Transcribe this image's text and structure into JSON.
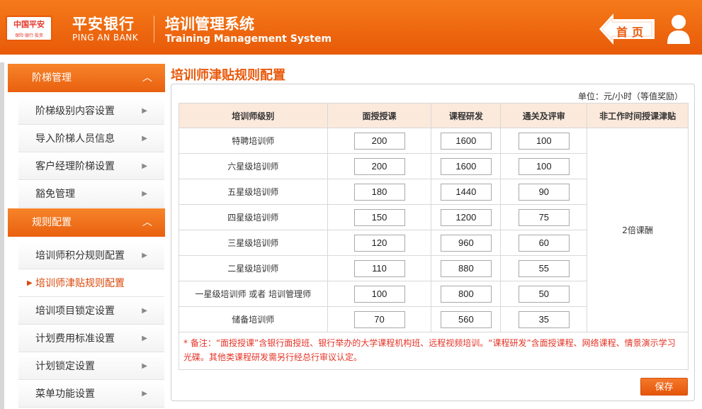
{
  "header": {
    "logo_text": "中国平安",
    "logo_sub": "保险·银行·投资",
    "bank_cn": "平安银行",
    "bank_en": "PING AN BANK",
    "system_cn": "培训管理系统",
    "system_en": "Training Management System",
    "home_label": "首页",
    "user_icon": "user-icon"
  },
  "sidebar": {
    "sections": [
      {
        "title": "阶梯管理",
        "items": [
          "阶梯级别内容设置",
          "导入阶梯人员信息",
          "客户经理阶梯设置",
          "豁免管理"
        ]
      },
      {
        "title": "规则配置",
        "items": [
          "培训师积分规则配置",
          "培训师津贴规则配置",
          "培训项目锁定设置",
          "计划费用标准设置",
          "计划锁定设置",
          "菜单功能设置"
        ]
      }
    ],
    "active_item": "培训师津贴规则配置"
  },
  "main": {
    "title": "培训师津贴规则配置",
    "unit": "单位：元/小时（等值奖励）",
    "columns": [
      "培训师级别",
      "面授授课",
      "课程研发",
      "通关及评审",
      "非工作时间授课津贴"
    ],
    "rows": [
      {
        "level": "特聘培训师",
        "face": "200",
        "dev": "1600",
        "review": "100"
      },
      {
        "level": "六星级培训师",
        "face": "200",
        "dev": "1600",
        "review": "100"
      },
      {
        "level": "五星级培训师",
        "face": "180",
        "dev": "1440",
        "review": "90"
      },
      {
        "level": "四星级培训师",
        "face": "150",
        "dev": "1200",
        "review": "75"
      },
      {
        "level": "三星级培训师",
        "face": "120",
        "dev": "960",
        "review": "60"
      },
      {
        "level": "二星级培训师",
        "face": "110",
        "dev": "880",
        "review": "55"
      },
      {
        "level": "一星级培训师 或者 培训管理师",
        "face": "100",
        "dev": "800",
        "review": "50"
      },
      {
        "level": "储备培训师",
        "face": "70",
        "dev": "560",
        "review": "35"
      }
    ],
    "off_hours_allowance": "2倍课酬",
    "note": "* 备注：“面授授课”含银行面授班、银行举办的大学课程机构班、远程视频培训。“课程研发”含面授课程、网络课程、情景演示学习光碟。其他类课程研发需另行经总行审议认定。",
    "save_label": "保存"
  },
  "colors": {
    "brand_orange": "#e9590b",
    "header_bg": "#f57a1a",
    "note_red": "#e43326",
    "table_head_bg": "#fbe9dc"
  }
}
